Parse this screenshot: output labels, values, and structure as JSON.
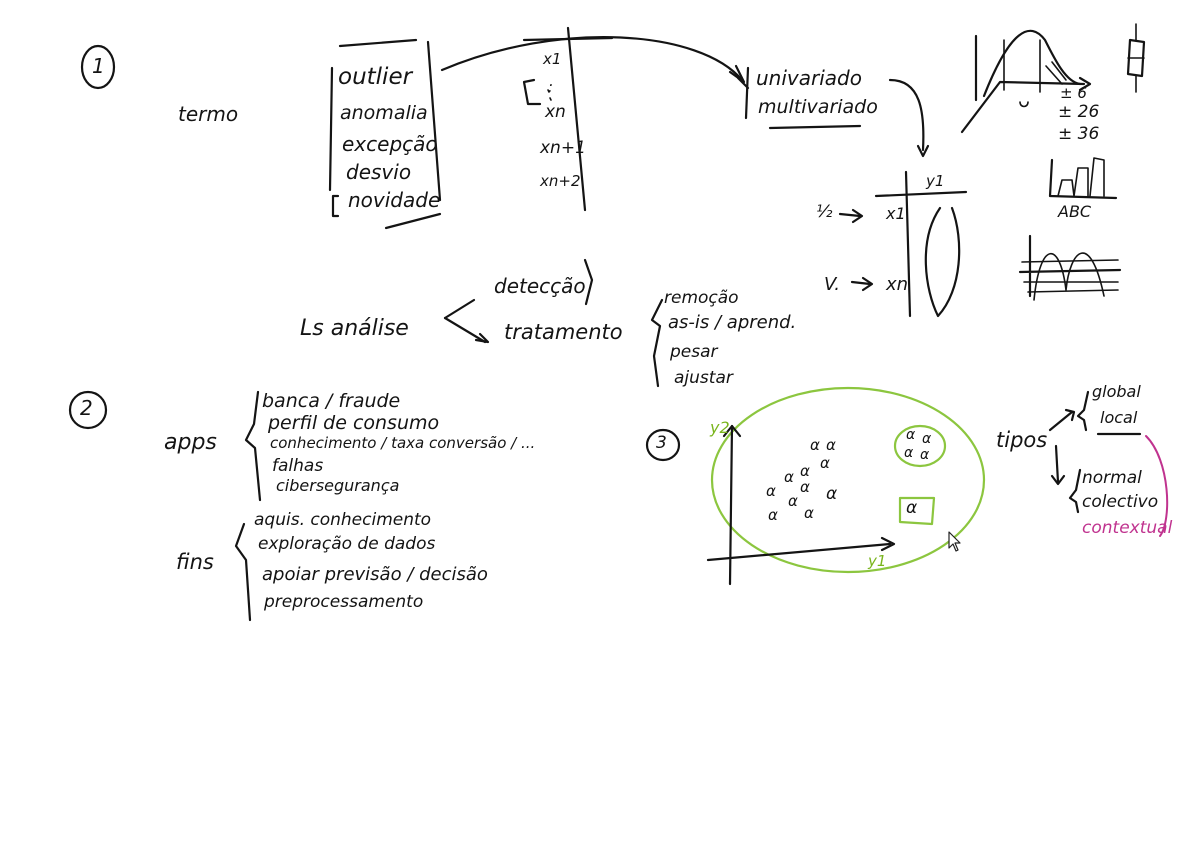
{
  "section1": {
    "number": "1",
    "termo": "termo",
    "terms": [
      "outlier",
      "anomalia",
      "excepção",
      "desvio",
      "novidade"
    ],
    "samples": [
      "x1",
      ":",
      "xn",
      "xn+1",
      "xn+2"
    ],
    "variate": [
      "univariado",
      "multivariado"
    ],
    "sigma": [
      "± 6",
      "± 26",
      "± 36"
    ],
    "abc": "ABC",
    "matrix": {
      "col": "y1",
      "row_top_left": "½",
      "row_top": "x1",
      "row_bottom_left": "V.",
      "row_bottom": "xn"
    },
    "analise": "Ls análise",
    "deteccao": "detecção",
    "tratamento": "tratamento",
    "treatments": [
      "remoção",
      "as-is / aprend.",
      "pesar",
      "ajustar"
    ]
  },
  "section2": {
    "number": "2",
    "apps_label": "apps",
    "apps": [
      "banca / fraude",
      "perfil de consumo",
      "conhecimento / taxa conversão / ...",
      "falhas",
      "cibersegurança"
    ],
    "fins_label": "fins",
    "fins": [
      "aquis. conhecimento",
      "exploração de dados",
      "apoiar previsão / decisão",
      "preprocessamento"
    ]
  },
  "section3": {
    "number": "3",
    "axis_y": "y2",
    "axis_x": "y1",
    "point_symbol": "α",
    "tipos_label": "tipos",
    "tipos_a": [
      "global",
      "local"
    ],
    "tipos_b": [
      "normal",
      "colectivo"
    ],
    "tipos_c": "contextual"
  },
  "colors": {
    "ink": "#141414",
    "green": "#8cc63f",
    "pink": "#c0338f",
    "background": "#ffffff"
  }
}
